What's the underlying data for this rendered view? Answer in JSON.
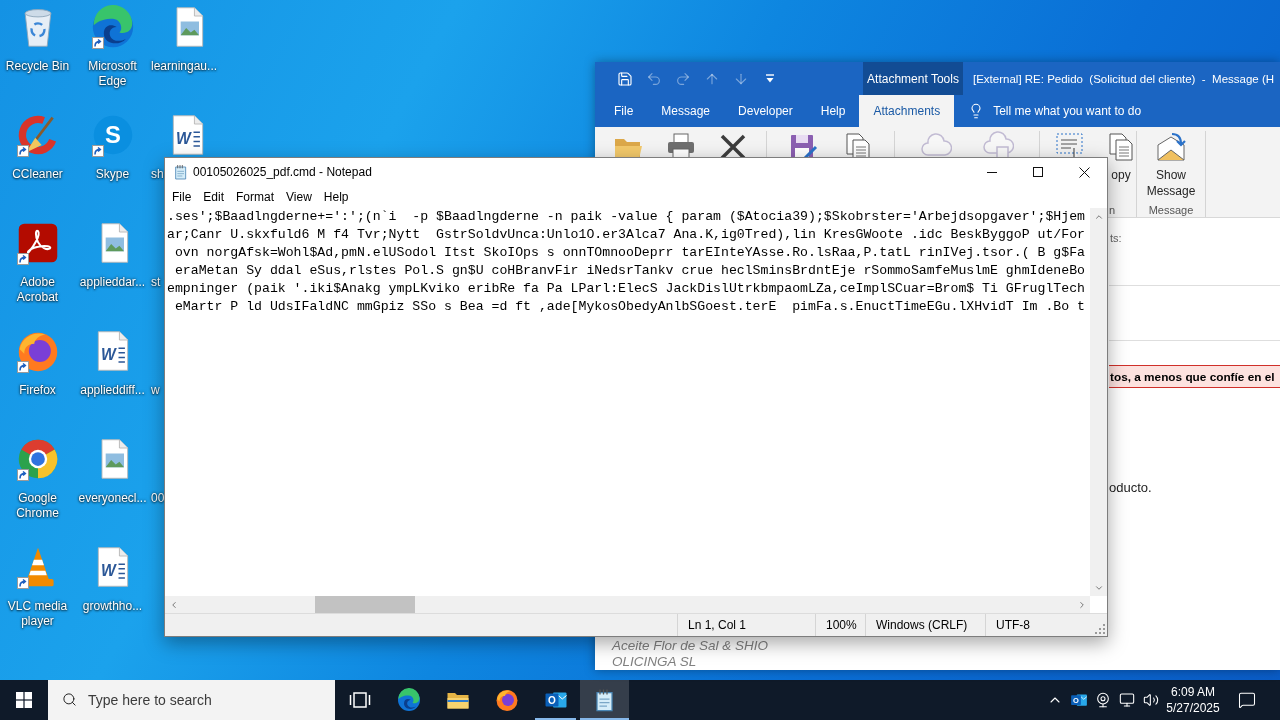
{
  "desktop": {
    "icons": [
      {
        "label": "Recycle Bin",
        "kind": "recycle-bin",
        "shortcut": false
      },
      {
        "label": "CCleaner",
        "kind": "ccleaner",
        "shortcut": true
      },
      {
        "label": "Adobe Acrobat",
        "kind": "acrobat",
        "shortcut": true
      },
      {
        "label": "Firefox",
        "kind": "firefox",
        "shortcut": true
      },
      {
        "label": "Google Chrome",
        "kind": "chrome",
        "shortcut": true
      },
      {
        "label": "VLC media player",
        "kind": "vlc",
        "shortcut": true
      },
      {
        "label": "Microsoft Edge",
        "kind": "edge",
        "shortcut": true
      },
      {
        "label": "Skype",
        "kind": "skype",
        "shortcut": true,
        "glyph": "S"
      },
      {
        "label": "applieddar...",
        "kind": "image-file",
        "shortcut": false
      },
      {
        "label": "applieddiff...",
        "kind": "word-doc",
        "shortcut": false,
        "glyph": "W"
      },
      {
        "label": "everyonecl...",
        "kind": "image-file",
        "shortcut": false
      },
      {
        "label": "growthho...",
        "kind": "word-doc",
        "shortcut": false,
        "glyph": "W"
      },
      {
        "label": "learningau...",
        "kind": "image-file",
        "shortcut": false
      },
      {
        "label": "sh",
        "kind": "word-doc",
        "shortcut": false,
        "glyph": "W"
      },
      {
        "label": "st",
        "kind": "covered"
      },
      {
        "label": "w",
        "kind": "covered"
      },
      {
        "label": "00",
        "kind": "covered"
      }
    ]
  },
  "outlook": {
    "quick_access": [
      {
        "kind": "save",
        "disabled": false
      },
      {
        "kind": "undo",
        "disabled": true
      },
      {
        "kind": "redo",
        "disabled": true
      },
      {
        "kind": "up",
        "disabled": true
      },
      {
        "kind": "down",
        "disabled": true
      },
      {
        "kind": "customize",
        "disabled": false
      }
    ],
    "context_header": "Attachment Tools",
    "title": "[External] RE: Pedido  (Solicitud del cliente)  -  Message (H",
    "tabs": [
      {
        "label": "File",
        "selected": false
      },
      {
        "label": "Message",
        "selected": false
      },
      {
        "label": "Developer",
        "selected": false
      },
      {
        "label": "Help",
        "selected": false
      },
      {
        "label": "Attachments",
        "selected": true
      }
    ],
    "tell_me": "Tell me what you want to do",
    "ribbon_groups": [
      {
        "buttons": [
          {
            "kind": "open",
            "disabled": false
          },
          {
            "kind": "print",
            "disabled": false
          },
          {
            "kind": "remove",
            "disabled": false
          }
        ]
      },
      {
        "buttons": [
          {
            "kind": "save-as",
            "disabled": false
          },
          {
            "kind": "copy",
            "disabled": false
          }
        ]
      },
      {
        "buttons": [
          {
            "kind": "cloud-upload",
            "disabled": true
          },
          {
            "kind": "cloud-copy",
            "disabled": true
          }
        ]
      },
      {
        "label": "n",
        "buttons": [
          {
            "kind": "select-all",
            "disabled": false
          },
          {
            "kind": "copy",
            "disabled": false,
            "label": "opy"
          }
        ]
      },
      {
        "label": "Message",
        "buttons": [
          {
            "kind": "show-message",
            "disabled": false,
            "label": "Show Message"
          }
        ]
      }
    ],
    "body": {
      "field_label": "ts:",
      "warning": "tos, a menos que confíe en el",
      "text": "oducto.",
      "signature": [
        "Aceite Flor de Sal & SHIO",
        "OLICINGA SL"
      ]
    }
  },
  "notepad": {
    "title": "00105026025_pdf.cmd - Notepad",
    "menu": [
      "File",
      "Edit",
      "Format",
      "View",
      "Help"
    ],
    "lines": [
      ".ses';$Baadlngderne+=':';(n`i  -p $Baadlngderne -n paik -value { param ($Atocia39);$Skobrster='Arbejdsopgaver';$Hjem",
      "ar;Canr U.skxfuld6 M f4 Tvr;Nytt  GstrSoldvUnca:Unlo1O.er3Alca7 Ana.K,ig0Tred),lin KresGWoote .idc BeskByggoP ut/For",
      " ovn norgAfsk=Wohl$Ad,pmN.elUSodol Itst SkoIOps s onnTOmnooDeprr tarEInteYAsse.Ro.lsRaa,P.tatL rinIVej.tsor.( B g$Fa",
      " eraMetan Sy ddal eSus,rlstes Pol.S gn$U coHBranvFir iNedsrTankv crue heclSminsBrdntEje rSommoSamfeMuslmE ghmIdeneBo",
      "empninger (paik '.iki$Anakg ympLKviko eribRe fa Pa LParl:ElecS JackDislUtrkbmpaomLZa,ceImplSCuar=Brom$ Ti GFruglTech",
      " eMartr P ld UdsIFaldNC mmGpiz SSo s Bea =d ft ,ade[MykosObedyAnlbSGoest.terE  pimFa.s.EnuctTimeEGu.lXHvidT Im .Bo t"
    ],
    "status": [
      "Ln 1, Col 1",
      "100%",
      "Windows (CRLF)",
      "UTF-8"
    ]
  },
  "taskbar": {
    "search_placeholder": "Type here to search",
    "apps": [
      {
        "kind": "task-view",
        "running": false,
        "selected": false
      },
      {
        "kind": "edge",
        "running": false,
        "selected": false
      },
      {
        "kind": "explorer",
        "running": false,
        "selected": false
      },
      {
        "kind": "firefox",
        "running": false,
        "selected": false
      },
      {
        "kind": "outlook",
        "running": true,
        "selected": false,
        "glyph": "O"
      },
      {
        "kind": "notepad",
        "running": true,
        "selected": true
      }
    ],
    "tray": [
      {
        "kind": "chevron"
      },
      {
        "kind": "outlook",
        "glyph": "O"
      },
      {
        "kind": "camera"
      },
      {
        "kind": "network"
      },
      {
        "kind": "volume"
      }
    ],
    "time": "6:09 AM",
    "date": "5/27/2025"
  }
}
